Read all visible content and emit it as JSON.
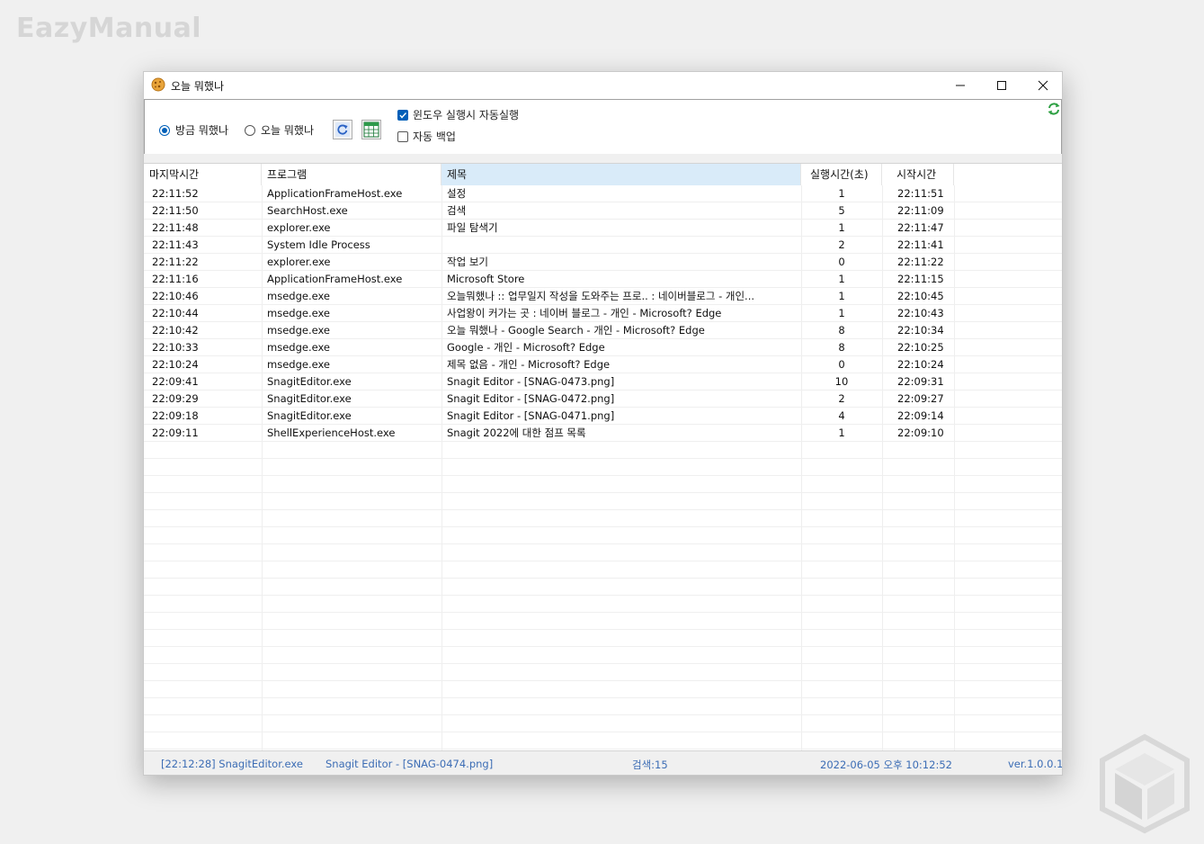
{
  "watermark": "EazyManual",
  "window": {
    "title": "오늘 뭐했나",
    "icon": "app-cookie-icon",
    "controls": [
      "minimize-icon",
      "maximize-icon",
      "close-icon"
    ]
  },
  "toolbar": {
    "radio_recent": "방금 뭐했나",
    "radio_today": "오늘 뭐했나",
    "refresh_icon": "refresh-icon",
    "export_icon": "excel-export-icon",
    "check_autostart": "윈도우 실행시 자동실행",
    "check_autostart_checked": true,
    "check_backup": "자동 백업",
    "check_backup_checked": false,
    "sync_icon": "sync-icon",
    "accent": "#005fb8"
  },
  "table": {
    "headers": [
      "마지막시간",
      "프로그램",
      "제목",
      "실행시간(초)",
      "시작시간"
    ],
    "rows": [
      [
        "22:11:52",
        "ApplicationFrameHost.exe",
        "설정",
        "1",
        "22:11:51"
      ],
      [
        "22:11:50",
        "SearchHost.exe",
        "검색",
        "5",
        "22:11:09"
      ],
      [
        "22:11:48",
        "explorer.exe",
        "파일 탐색기",
        "1",
        "22:11:47"
      ],
      [
        "22:11:43",
        "System Idle Process",
        "",
        "2",
        "22:11:41"
      ],
      [
        "22:11:22",
        "explorer.exe",
        "작업 보기",
        "0",
        "22:11:22"
      ],
      [
        "22:11:16",
        "ApplicationFrameHost.exe",
        "Microsoft Store",
        "1",
        "22:11:15"
      ],
      [
        "22:10:46",
        "msedge.exe",
        "오늘뭐했나 :: 업무일지 작성을 도와주는 프로.. : 네이버블로그 - 개인...",
        "1",
        "22:10:45"
      ],
      [
        "22:10:44",
        "msedge.exe",
        "사업왕이 커가는 곳 : 네이버 블로그 - 개인 - Microsoft? Edge",
        "1",
        "22:10:43"
      ],
      [
        "22:10:42",
        "msedge.exe",
        "오늘 뭐했나 - Google Search - 개인 - Microsoft? Edge",
        "8",
        "22:10:34"
      ],
      [
        "22:10:33",
        "msedge.exe",
        "Google - 개인 - Microsoft? Edge",
        "8",
        "22:10:25"
      ],
      [
        "22:10:24",
        "msedge.exe",
        "제목 없음 - 개인 - Microsoft? Edge",
        "0",
        "22:10:24"
      ],
      [
        "22:09:41",
        "SnagitEditor.exe",
        "Snagit Editor - [SNAG-0473.png]",
        "10",
        "22:09:31"
      ],
      [
        "22:09:29",
        "SnagitEditor.exe",
        "Snagit Editor - [SNAG-0472.png]",
        "2",
        "22:09:27"
      ],
      [
        "22:09:18",
        "SnagitEditor.exe",
        "Snagit Editor - [SNAG-0471.png]",
        "4",
        "22:09:14"
      ],
      [
        "22:09:11",
        "ShellExperienceHost.exe",
        "Snagit 2022에 대한 점프 목록",
        "1",
        "22:09:10"
      ]
    ]
  },
  "status": {
    "current": "[22:12:28] SnagitEditor.exe",
    "current_title": "Snagit Editor - [SNAG-0474.png]",
    "count": "검색:15",
    "datetime": "2022-06-05 오후 10:12:52",
    "version": "ver.1.0.0.1",
    "color": "#3c6db5"
  }
}
